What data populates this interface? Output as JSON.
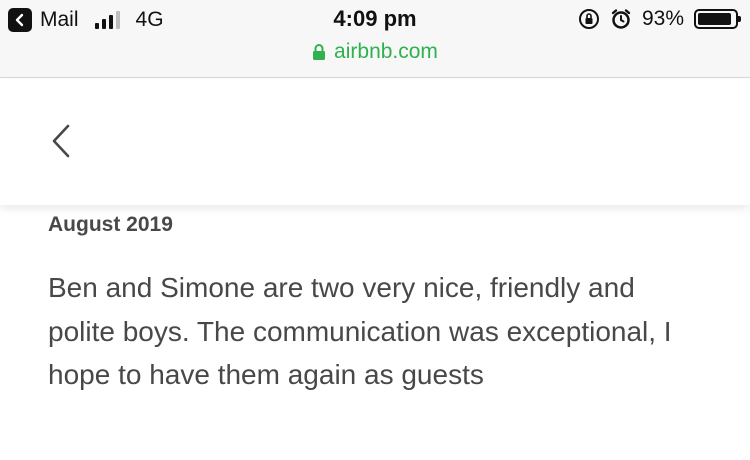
{
  "status_bar": {
    "back_app_label": "Mail",
    "network": "4G",
    "time": "4:09 pm",
    "battery_percent": "93%",
    "battery_level": 0.93,
    "signal_bars_active": 3,
    "signal_bars_total": 4,
    "icons": [
      "back-to-app-icon",
      "signal-icon",
      "orientation-lock-icon",
      "alarm-icon",
      "battery-icon",
      "lock-icon"
    ]
  },
  "browser": {
    "url": "airbnb.com",
    "url_color": "#2fb150"
  },
  "header": {
    "back_icon": "chevron-left-icon"
  },
  "review": {
    "date": "August 2019",
    "text": "Ben and Simone are two very nice, friendly and polite boys. The communication was exceptional, I hope to have them again as guests"
  }
}
